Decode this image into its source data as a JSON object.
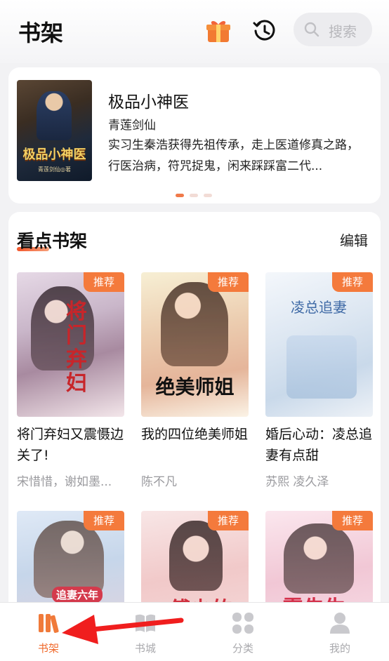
{
  "header": {
    "title": "书架",
    "gift_icon": "gift-icon",
    "history_icon": "history-icon",
    "search_placeholder": "搜索"
  },
  "featured": {
    "title": "极品小神医",
    "author": "青莲剑仙",
    "description": "实习生秦浩获得先祖传承，走上医道修真之路，行医治病，符咒捉鬼，闲来踩踩富二代...",
    "cover_title": "极品小神医",
    "cover_caption": "青莲剑仙◎著",
    "carousel_pages": 3,
    "carousel_active": 1
  },
  "shelf": {
    "title": "看点书架",
    "edit_label": "编辑",
    "badge_label": "推荐",
    "books": [
      {
        "title": "将门弃妇又震慑边关了!",
        "author": "宋惜惜，谢如墨...",
        "cover_text": "将门弃妇"
      },
      {
        "title": "我的四位绝美师姐",
        "author": "陈不凡",
        "cover_text": "绝美师姐"
      },
      {
        "title": "婚后心动：凌总追妻有点甜",
        "author": "苏熙   凌久泽",
        "cover_text": "凌总追妻"
      },
      {
        "title": "",
        "author": "",
        "cover_text": "追妻六年"
      },
      {
        "title": "",
        "author": "",
        "cover_text": "傅少的"
      },
      {
        "title": "",
        "author": "",
        "cover_text": "霍先生"
      }
    ]
  },
  "tabbar": {
    "items": [
      {
        "label": "书架",
        "icon": "bookshelf-icon",
        "active": true
      },
      {
        "label": "书城",
        "icon": "book-store-icon",
        "active": false
      },
      {
        "label": "分类",
        "icon": "category-icon",
        "active": false
      },
      {
        "label": "我的",
        "icon": "profile-icon",
        "active": false
      }
    ]
  },
  "colors": {
    "accent": "#f06a2c",
    "badge": "#f47a3c",
    "annotation_arrow": "#f01e1e"
  }
}
